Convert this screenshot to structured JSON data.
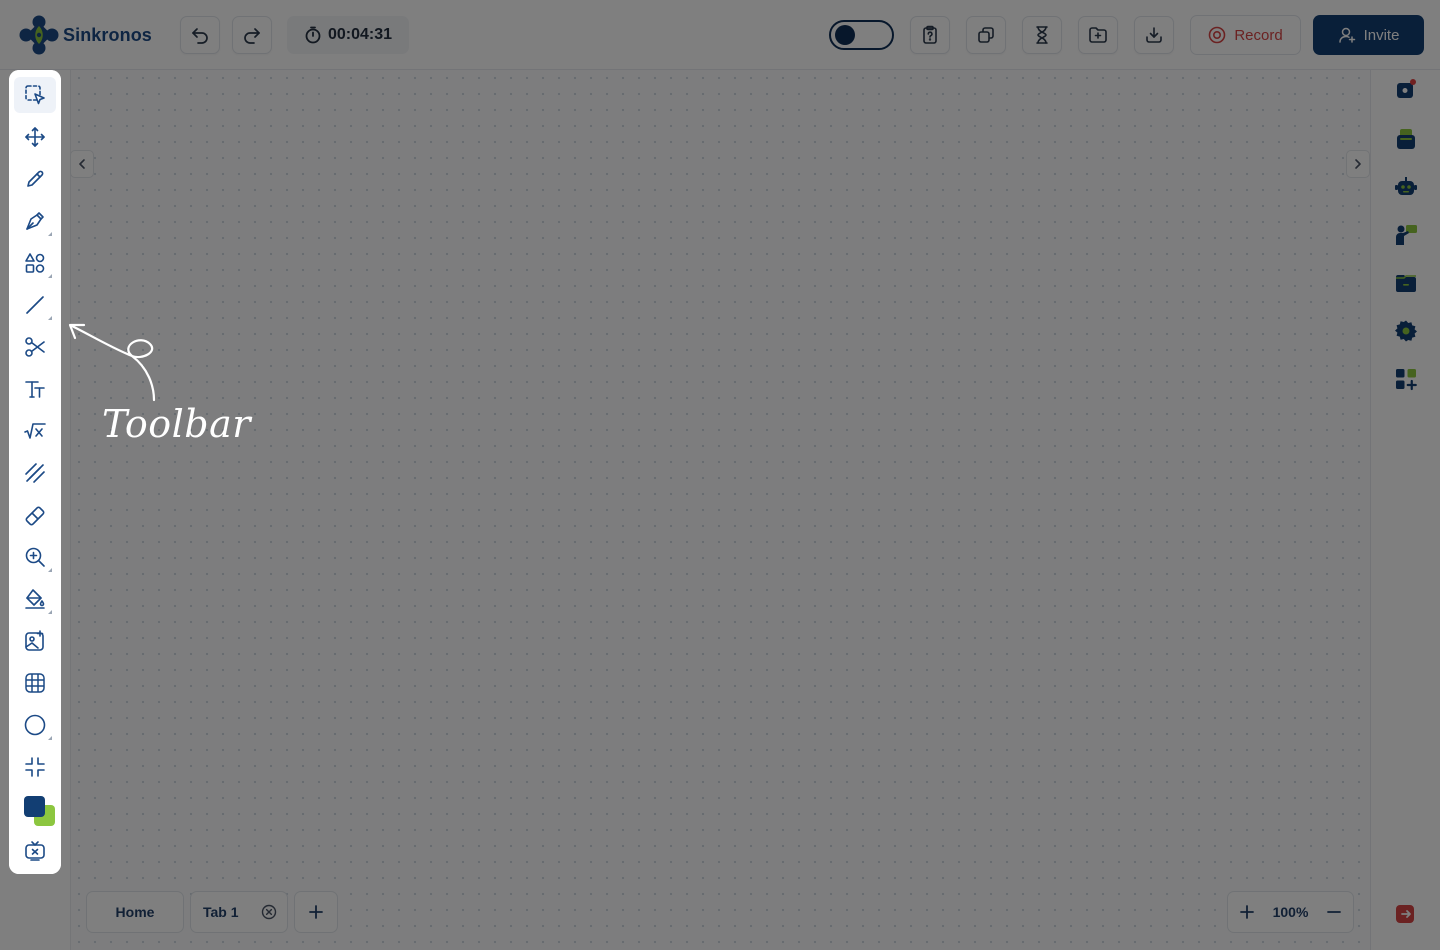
{
  "app": {
    "name": "Sinkronos"
  },
  "header": {
    "timer": "00:04:31",
    "record_label": "Record",
    "invite_label": "Invite"
  },
  "toolbar": {
    "tools": [
      {
        "name": "select",
        "icon": "select-icon",
        "active": true
      },
      {
        "name": "pan",
        "icon": "move-icon"
      },
      {
        "name": "pencil",
        "icon": "pencil-icon"
      },
      {
        "name": "pen",
        "icon": "pen-icon"
      },
      {
        "name": "shapes",
        "icon": "shapes-icon"
      },
      {
        "name": "line",
        "icon": "line-icon"
      },
      {
        "name": "cut",
        "icon": "scissors-icon"
      },
      {
        "name": "text",
        "icon": "text-icon"
      },
      {
        "name": "math",
        "icon": "sqrt-x-icon"
      },
      {
        "name": "laser",
        "icon": "laser-icon"
      },
      {
        "name": "eraser",
        "icon": "eraser-icon"
      },
      {
        "name": "zoom",
        "icon": "zoom-in-icon"
      },
      {
        "name": "fill",
        "icon": "paint-bucket-icon"
      },
      {
        "name": "image",
        "icon": "image-sparkle-icon"
      },
      {
        "name": "grid",
        "icon": "grid-globe-icon"
      },
      {
        "name": "circle",
        "icon": "circle-icon"
      },
      {
        "name": "collapse",
        "icon": "minimize-icon"
      },
      {
        "name": "colors",
        "icon": "color-swatch-icon",
        "colors": [
          "#123e73",
          "#8cc63f"
        ]
      },
      {
        "name": "ai",
        "icon": "tv-robot-icon"
      }
    ]
  },
  "rightbar": {
    "items": [
      "notification-chat-icon",
      "stacked-cards-icon",
      "robot-icon",
      "teacher-icon",
      "folder-icon",
      "settings-icon",
      "apps-add-icon"
    ]
  },
  "tabs": {
    "home_label": "Home",
    "tab1_label": "Tab 1"
  },
  "zoom": {
    "level": "100%"
  },
  "annotation": {
    "text": "Toolbar"
  },
  "colors": {
    "brand_dark": "#123e73",
    "brand_green": "#8cc63f",
    "record_red": "#d64545"
  }
}
